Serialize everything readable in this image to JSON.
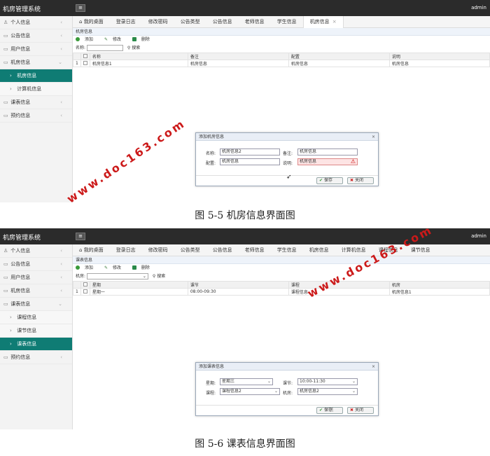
{
  "app": {
    "title": "机房管理系统",
    "user": "admin"
  },
  "watermark": "www.doc163.com",
  "shot1": {
    "sidebar": [
      {
        "label": "个人信息",
        "icon": "user-icon"
      },
      {
        "label": "公告信息",
        "icon": "notice-icon"
      },
      {
        "label": "用户信息",
        "icon": "users-icon"
      },
      {
        "label": "机房信息",
        "icon": "room-icon"
      },
      {
        "label": "机房信息",
        "icon": "chevron-right-icon"
      },
      {
        "label": "计算机信息",
        "icon": "chevron-right-icon"
      },
      {
        "label": "课表信息",
        "icon": "schedule-icon"
      },
      {
        "label": "预约信息",
        "icon": "booking-icon"
      }
    ],
    "tabs": [
      "我的桌面",
      "登录日志",
      "修改密码",
      "公告类型",
      "公告信息",
      "老师信息",
      "学生信息",
      "机房信息"
    ],
    "page_title": "机房信息",
    "toolbar": {
      "add": "添加",
      "edit": "修改",
      "delete": "删除"
    },
    "search": {
      "label": "名称:",
      "button": "搜索"
    },
    "table": {
      "headers": [
        "名称",
        "备注",
        "配置",
        "说明"
      ],
      "rows": [
        {
          "no": "1",
          "cells": [
            "机房信息1",
            "机房信息",
            "机房信息",
            "机房信息"
          ]
        }
      ]
    },
    "dialog": {
      "title": "添加机房信息",
      "name_label": "名称:",
      "name_value": "机房信息2",
      "remark_label": "备注:",
      "remark_value": "机房信息",
      "config_label": "配置:",
      "config_value": "机房信息",
      "desc_label": "说明:",
      "desc_value": "机房信息",
      "save": "保存",
      "close": "关闭"
    },
    "caption": "图 5-5 机房信息界面图"
  },
  "shot2": {
    "sidebar": [
      {
        "label": "个人信息"
      },
      {
        "label": "公告信息"
      },
      {
        "label": "用户信息"
      },
      {
        "label": "机房信息"
      },
      {
        "label": "课表信息"
      },
      {
        "label": "课程信息"
      },
      {
        "label": "课节信息"
      },
      {
        "label": "课表信息"
      },
      {
        "label": "预约信息"
      }
    ],
    "tabs": [
      "我的桌面",
      "登录日志",
      "修改密码",
      "公告类型",
      "公告信息",
      "老师信息",
      "学生信息",
      "机房信息",
      "计算机信息",
      "课程信息",
      "课节信息"
    ],
    "page_title": "课表信息",
    "toolbar": {
      "add": "添加",
      "edit": "修改",
      "delete": "删除"
    },
    "search": {
      "label": "机房:",
      "button": "搜索"
    },
    "table": {
      "headers": [
        "星期",
        "课节",
        "课程",
        "机房"
      ],
      "rows": [
        {
          "no": "1",
          "cells": [
            "星期一",
            "08:00-09:30",
            "课程信息",
            "机房信息1"
          ]
        }
      ]
    },
    "dialog": {
      "title": "添加课表信息",
      "week_label": "星期:",
      "week_value": "星期三",
      "period_label": "课节:",
      "period_value": "10:00-11:30",
      "course_label": "课程:",
      "course_value": "课程信息2",
      "room_label": "机房:",
      "room_value": "机房信息2",
      "save": "保存",
      "close": "关闭"
    },
    "caption": "图 5-6 课表信息界面图"
  },
  "colors": {
    "topbar": "#2b2b2b",
    "active": "#0f7c74",
    "watermark": "#cc1a1a"
  }
}
